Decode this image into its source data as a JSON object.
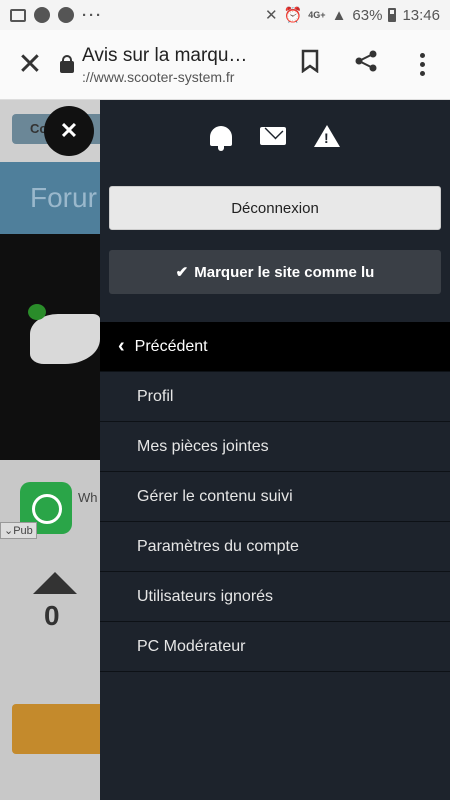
{
  "status_bar": {
    "left_icons": [
      "image-icon",
      "face-icon",
      "face-icon",
      "more-dots-icon"
    ],
    "network": "4G+",
    "battery": "63%",
    "time": "13:46"
  },
  "browser": {
    "title": "Avis sur la marqu…",
    "url": "://www.scooter-system.fr"
  },
  "background_page": {
    "crumb": "Co",
    "forum_fragment": "Forur",
    "ad_app_fragment": "Wh",
    "pub_label": "Pub",
    "vote_count": "0"
  },
  "menu": {
    "icons": [
      "bell-icon",
      "mail-icon",
      "warning-icon"
    ],
    "logout_label": "Déconnexion",
    "mark_read_label": "Marquer le site comme lu",
    "back_label": "Précédent",
    "items": [
      {
        "label": "Profil"
      },
      {
        "label": "Mes pièces jointes"
      },
      {
        "label": "Gérer le contenu suivi"
      },
      {
        "label": "Paramètres du compte"
      },
      {
        "label": "Utilisateurs ignorés"
      },
      {
        "label": "PC Modérateur"
      }
    ]
  }
}
